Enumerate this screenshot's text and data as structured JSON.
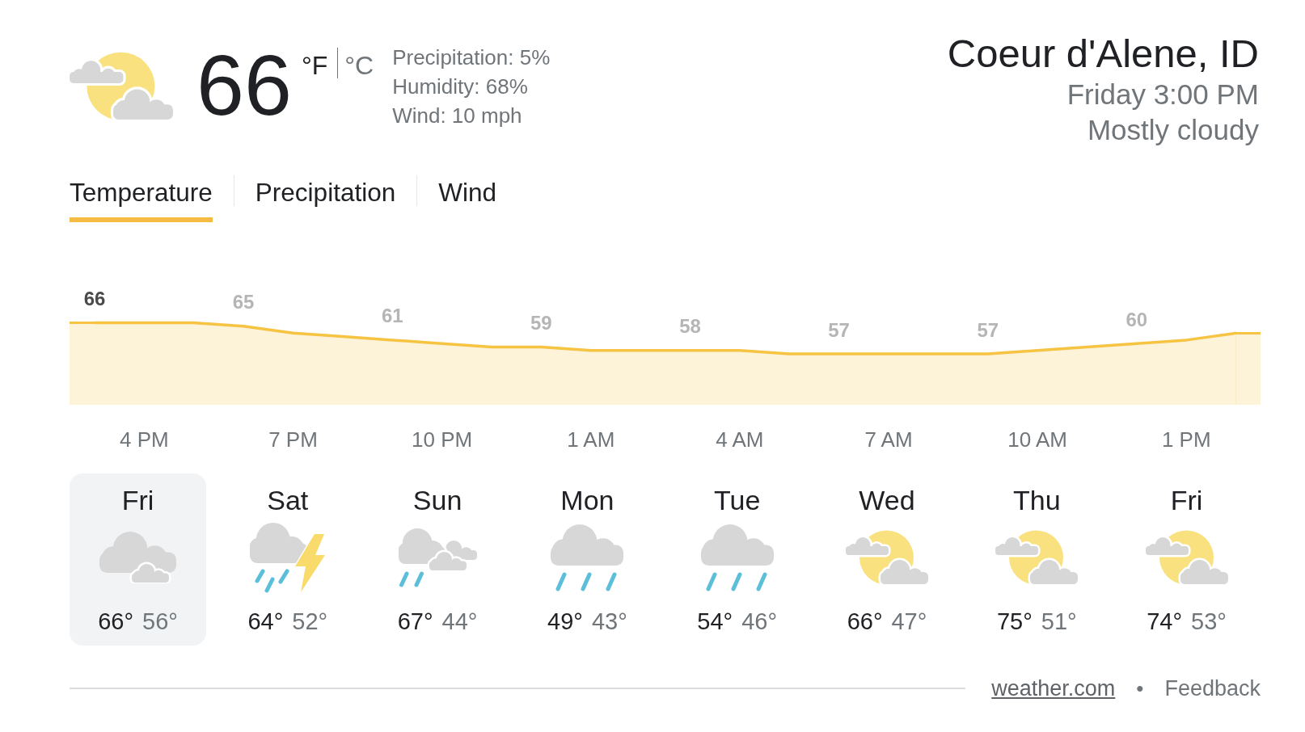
{
  "current": {
    "kind": "partlycloudy",
    "temperature": "66",
    "units": [
      {
        "label": "°F",
        "selected": true
      },
      {
        "label": "°C",
        "selected": false
      }
    ],
    "details": [
      "Precipitation: 5%",
      "Humidity: 68%",
      "Wind: 10 mph"
    ]
  },
  "location": {
    "name": "Coeur d'Alene, ID",
    "time": "Friday 3:00 PM",
    "condition": "Mostly cloudy"
  },
  "tabs": [
    {
      "label": "Temperature",
      "selected": true
    },
    {
      "label": "Precipitation",
      "selected": false
    },
    {
      "label": "Wind",
      "selected": false
    }
  ],
  "hourly": {
    "chart_data": [
      {
        "type": "area",
        "color": "#f6c342",
        "categories": [
          null,
          "4 PM",
          null,
          null,
          "7 PM",
          null,
          null,
          "10 PM",
          null,
          null,
          "1 AM",
          null,
          null,
          "4 AM",
          null,
          null,
          "7 AM",
          null,
          null,
          "10 AM",
          null,
          null,
          "1 PM",
          null
        ],
        "values": [
          66,
          66,
          66,
          65,
          63,
          62,
          61,
          60,
          59,
          59,
          58,
          58,
          58,
          58,
          57,
          57,
          57,
          57,
          57,
          58,
          59,
          60,
          61,
          63
        ],
        "value_labels": [
          null,
          null,
          null,
          "65",
          null,
          null,
          "61",
          null,
          null,
          "59",
          null,
          null,
          "58",
          null,
          null,
          "57",
          null,
          null,
          "57",
          null,
          null,
          "60",
          null,
          null
        ],
        "annotations": [
          "66"
        ]
      }
    ]
  },
  "days": [
    {
      "day": "Fri",
      "kind": "cloudy",
      "high": "66°",
      "low": "56°",
      "selected": true
    },
    {
      "day": "Sat",
      "kind": "thunderstorm",
      "high": "64°",
      "low": "52°",
      "selected": false
    },
    {
      "day": "Sun",
      "kind": "showers",
      "high": "67°",
      "low": "44°",
      "selected": false
    },
    {
      "day": "Mon",
      "kind": "rain",
      "high": "49°",
      "low": "43°",
      "selected": false
    },
    {
      "day": "Tue",
      "kind": "rain",
      "high": "54°",
      "low": "46°",
      "selected": false
    },
    {
      "day": "Wed",
      "kind": "partlycloudy",
      "high": "66°",
      "low": "47°",
      "selected": false
    },
    {
      "day": "Thu",
      "kind": "partlycloudy",
      "high": "75°",
      "low": "51°",
      "selected": false
    },
    {
      "day": "Fri",
      "kind": "partlycloudy",
      "high": "74°",
      "low": "53°",
      "selected": false
    }
  ],
  "footer": {
    "source": "weather.com",
    "separator": "•",
    "feedback": "Feedback"
  }
}
